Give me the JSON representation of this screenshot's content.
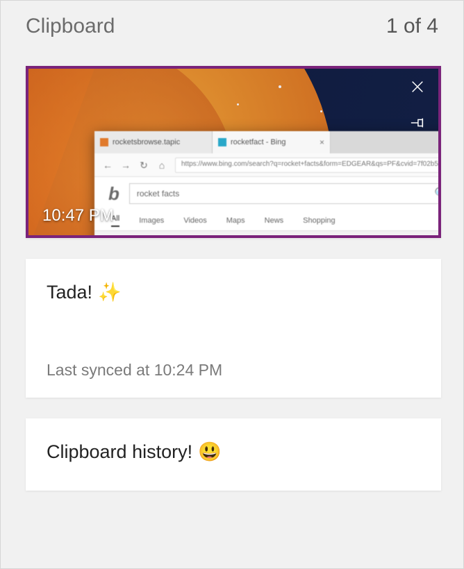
{
  "header": {
    "title": "Clipboard",
    "counter": "1 of 4"
  },
  "items": [
    {
      "kind": "image",
      "timestamp": "10:47 PM",
      "selected": true,
      "preview": {
        "tab1": "rocketsbrowse.tapic",
        "tab2": "rocketfact - Bing",
        "url": "https://www.bing.com/search?q=rocket+facts&form=EDGEAR&qs=PF&cvid=7f02b5a...",
        "search_query": "rocket facts",
        "result_tabs": [
          "All",
          "Images",
          "Videos",
          "Maps",
          "News",
          "Shopping"
        ]
      }
    },
    {
      "kind": "text",
      "text": "Tada!",
      "emoji": "✨",
      "sync": "Last synced at 10:24 PM"
    },
    {
      "kind": "text",
      "text": "Clipboard history!",
      "emoji": "😃"
    }
  ],
  "icons": {
    "close": "close-icon",
    "pin": "pin-icon"
  }
}
